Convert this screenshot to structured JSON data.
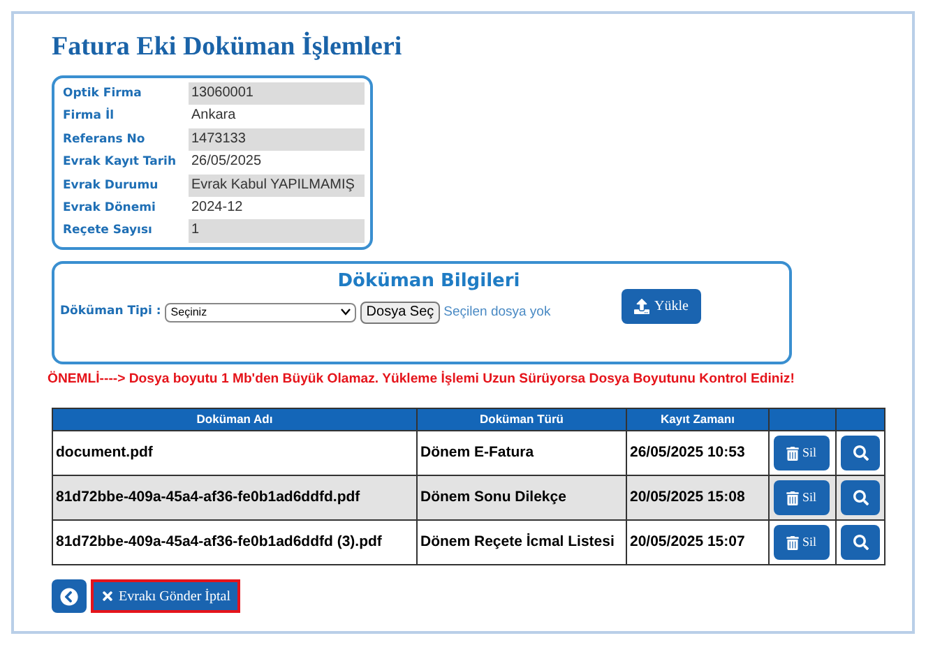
{
  "title": "Fatura Eki Doküman İşlemleri",
  "info": [
    {
      "label": "Optik Firma",
      "value": "13060001"
    },
    {
      "label": "Firma İl",
      "value": "Ankara"
    },
    {
      "label": "Referans No",
      "value": "1473133"
    },
    {
      "label": "Evrak Kayıt Tarih",
      "value": "26/05/2025"
    },
    {
      "label": "Evrak Durumu",
      "value": "Evrak Kabul YAPILMAMIŞ"
    },
    {
      "label": "Evrak Dönemi",
      "value": "2024-12"
    },
    {
      "label": "Reçete Sayısı",
      "value": "1"
    }
  ],
  "document_panel": {
    "title": "Döküman Bilgileri",
    "type_label": "Döküman Tipi :",
    "type_value": "Seçiniz",
    "file_button": "Dosya Seç",
    "file_status": "Seçilen dosya yok",
    "upload_button": "Yükle"
  },
  "warning": "ÖNEMLİ----> Dosya boyutu 1 Mb'den Büyük Olamaz. Yükleme İşlemi Uzun Sürüyorsa Dosya Boyutunu Kontrol Ediniz!",
  "table": {
    "columns": [
      "Doküman Adı",
      "Doküman Türü",
      "Kayıt Zamanı"
    ],
    "rows": [
      {
        "name": "document.pdf",
        "type": "Dönem E-Fatura",
        "time": "26/05/2025 10:53",
        "delete": "Sil"
      },
      {
        "name": "81d72bbe-409a-45a4-af36-fe0b1ad6ddfd.pdf",
        "type": "Dönem Sonu Dilekçe",
        "time": "20/05/2025 15:08",
        "delete": "Sil"
      },
      {
        "name": "81d72bbe-409a-45a4-af36-fe0b1ad6ddfd (3).pdf",
        "type": "Dönem Reçete İcmal Listesi",
        "time": "20/05/2025 15:07",
        "delete": "Sil"
      }
    ]
  },
  "cancel_button": "Evrakı Gönder İptal"
}
